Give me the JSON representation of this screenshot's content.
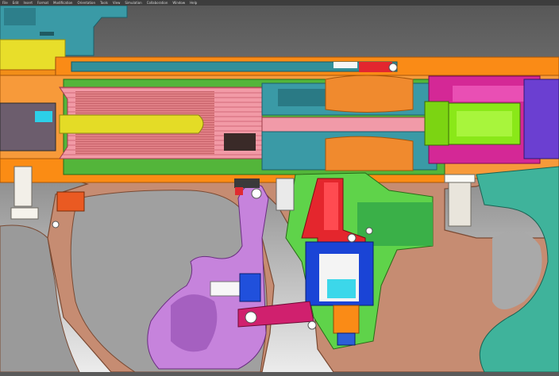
{
  "app": {
    "menu": [
      "File",
      "Edit",
      "Insert",
      "Format",
      "Modification",
      "Orientation",
      "Tools",
      "View",
      "Simulation",
      "Collaboration",
      "Window",
      "Help"
    ]
  },
  "view": {
    "mode": "section-view",
    "background_top": "#565656",
    "background_bottom": "#ececec"
  },
  "colors": {
    "housing": "#c89073",
    "orange": "#fb8c14",
    "teal": "#2f8c93",
    "pink": "#f08fa0",
    "magenta": "#d9249b",
    "lime": "#8ee81a",
    "yellow": "#dfdc28",
    "purple": "#c080d8",
    "blue": "#1c48d8",
    "red": "#e32a32",
    "green": "#3faa38",
    "mint": "#3fb39b"
  }
}
